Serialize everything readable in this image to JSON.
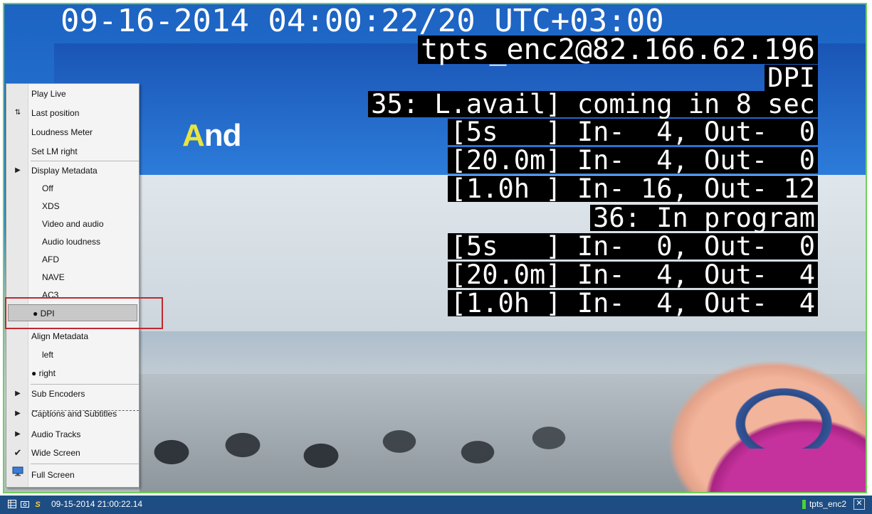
{
  "overlay": {
    "datetime": "09-16-2014 04:00:22/20 UTC+03:00",
    "encoder": "tpts_enc2@82.166.62.196",
    "mode": "DPI",
    "event35_header": "35: L.avail] coming in 8 sec",
    "event35_rows": [
      "[5s   ] In-  4, Out-  0",
      "[20.0m] In-  4, Out-  0",
      "[1.0h ] In- 16, Out- 12"
    ],
    "event36_header": "36: In program",
    "event36_rows": [
      "[5s   ] In-  0, Out-  0",
      "[20.0m] In-  4, Out-  4",
      "[1.0h ] In-  4, Out-  4"
    ]
  },
  "video_text": {
    "logo_a": "A",
    "logo_rest": "nd"
  },
  "menu": {
    "play_live": "Play Live",
    "last_position": "Last position",
    "loudness_meter": "Loudness Meter",
    "set_lm_right": "Set LM right",
    "display_metadata": "Display Metadata",
    "metadata_options": [
      "Off",
      "XDS",
      "Video and audio",
      "Audio loudness",
      "AFD",
      "NAVE",
      "AC3",
      "DPI"
    ],
    "selected_metadata": "DPI",
    "align_metadata": "Align Metadata",
    "align_left": "left",
    "align_right": "right",
    "sub_encoders": "Sub Encoders",
    "captions_subtitles": "Captions and Subtitles",
    "audio_tracks": "Audio Tracks",
    "wide_screen": "Wide Screen",
    "full_screen": "Full Screen"
  },
  "status_bar": {
    "timestamp": "09-15-2014 21:00:22.14",
    "encoder_name": "tpts_enc2",
    "encoder_indicator_color": "#4cd137"
  },
  "icons": [
    "grid-icon",
    "screenshot-icon",
    "s-logo-icon",
    "checkmark-icon",
    "monitor-icon",
    "submenu-arrow-icon",
    "close-icon"
  ]
}
